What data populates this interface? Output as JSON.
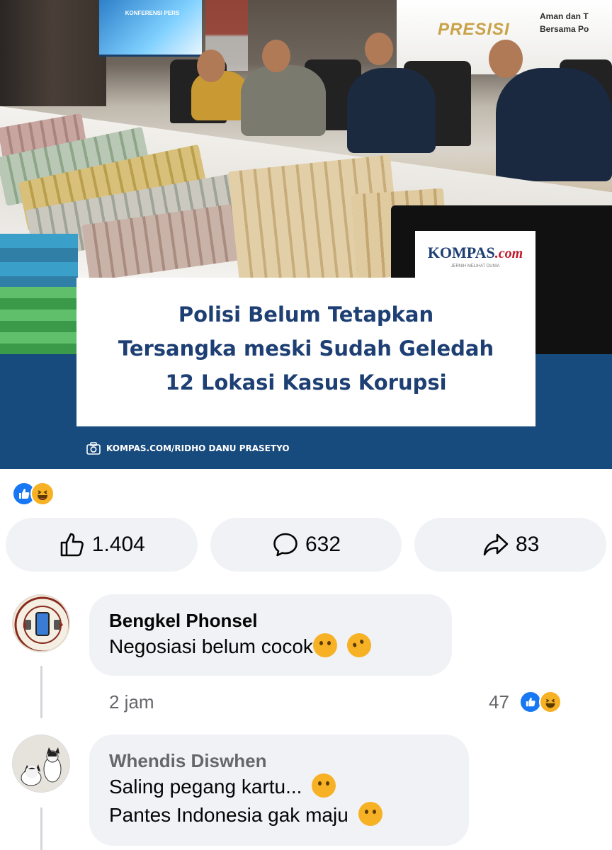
{
  "post": {
    "image": {
      "backdrop_banner_word": "PRESISI",
      "backdrop_banner_sub": [
        "Aman dan T",
        "Bersama Po"
      ],
      "screen_text": "KONFERENSI PERS",
      "publisher_logo": "KOMPAS",
      "publisher_logo_suffix": ".com",
      "publisher_tagline": "JERNIH MELIHAT DUNIA",
      "headline_lines": [
        "Polisi Belum Tetapkan",
        "Tersangka meski Sudah Geledah",
        "12 Lokasi Kasus Korupsi"
      ],
      "photo_credit": "KOMPAS.COM/RIDHO DANU PRASETYO",
      "band_color": "#174a7d",
      "brand_color": "#1d3f73"
    },
    "reactions": [
      "like-icon",
      "haha-icon"
    ],
    "actions": {
      "like_count": "1.404",
      "comment_count": "632",
      "share_count": "83"
    }
  },
  "comments": [
    {
      "author": "Bengkel Phonsel",
      "text": "Negosiasi belum cocok",
      "emojis": [
        "face-with-open-eyes-and-hand-over-mouth",
        "rolling-on-floor-laughing"
      ],
      "time": "2 jam",
      "reaction_count": "47",
      "avatar_text": [
        "BENGKEL PHONSEL STORE",
        "RANTAU KASAI"
      ]
    },
    {
      "author": "Whendis Diswhen",
      "lines": [
        "Saling pegang kartu...",
        "Pantes Indonesia gak maju"
      ],
      "emojis": [
        "face-with-hand-over-mouth",
        "face-with-hand-over-mouth"
      ]
    }
  ],
  "colors": {
    "like_blue": "#1877f2",
    "haha_yellow": "#f7b125",
    "button_bg": "#f0f2f5",
    "muted_text": "#65676b"
  }
}
